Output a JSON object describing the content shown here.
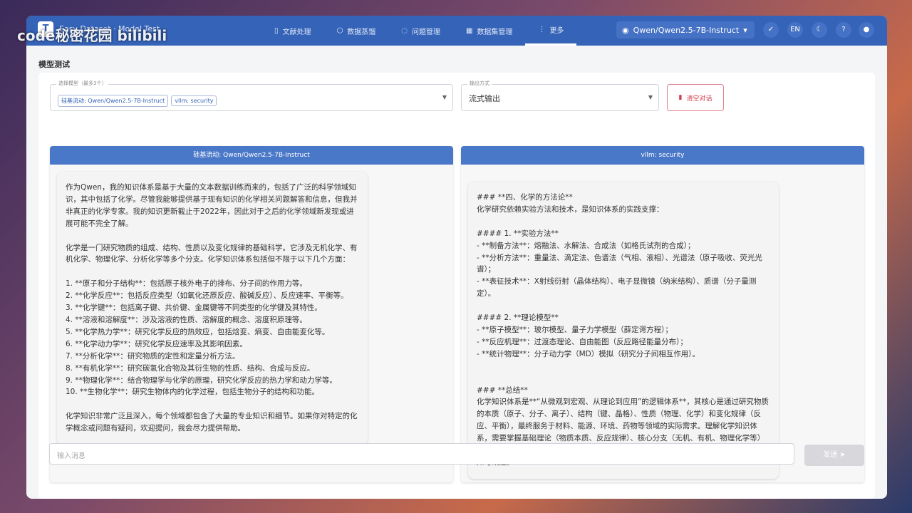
{
  "watermark": "code秘密花园 bilibili",
  "header": {
    "logo": "T",
    "project": "Easy Dataset · Model Test",
    "nav": [
      {
        "icon": "document-icon",
        "label": "文献处理"
      },
      {
        "icon": "cube-icon",
        "label": "数据蒸馏"
      },
      {
        "icon": "chat-icon",
        "label": "问题管理"
      },
      {
        "icon": "dataset-icon",
        "label": "数据集管理"
      },
      {
        "icon": "more-vert-icon",
        "label": "更多"
      }
    ],
    "model": "Qwen/Qwen2.5-7B-Instruct",
    "icons": [
      "check-icon",
      "EN",
      "moon-icon",
      "help-icon",
      "github-icon"
    ]
  },
  "page_title": "模型测试",
  "controls": {
    "model_label": "选择模型（最多3个）",
    "models": [
      "硅基流动: Qwen/Qwen2.5-7B-Instruct",
      "vllm: security"
    ],
    "output_label": "输出方式",
    "output_value": "流式输出",
    "clear_label": "清空对话"
  },
  "panes": [
    {
      "title": "硅基流动: Qwen/Qwen2.5-7B-Instruct",
      "text": "作为Qwen，我的知识体系是基于大量的文本数据训练而来的，包括了广泛的科学领域知识，其中包括了化学。尽管我能够提供基于现有知识的化学相关问题解答和信息，但我并非真正的化学专家。我的知识更新截止于2022年，因此对于之后的化学领域新发现或进展可能不完全了解。\n\n化学是一门研究物质的组成、结构、性质以及变化规律的基础科学。它涉及无机化学、有机化学、物理化学、分析化学等多个分支。化学知识体系包括但不限于以下几个方面：\n\n1. **原子和分子结构**：包括原子核外电子的排布、分子间的作用力等。\n2. **化学反应**：包括反应类型（如氧化还原反应、酸碱反应）、反应速率、平衡等。\n3. **化学键**：包括离子键、共价键、金属键等不同类型的化学键及其特性。\n4. **溶液和溶解度**：涉及溶液的性质、溶解度的概念、溶度积原理等。\n5. **化学热力学**：研究化学反应的热效应，包括焓变、熵变、自由能变化等。\n6. **化学动力学**：研究化学反应速率及其影响因素。\n7. **分析化学**：研究物质的定性和定量分析方法。\n8. **有机化学**：研究碳氢化合物及其衍生物的性质、结构、合成与反应。\n9. **物理化学**：结合物理学与化学的原理，研究化学反应的热力学和动力学等。\n10. **生物化学**：研究生物体内的化学过程，包括生物分子的结构和功能。\n\n化学知识非常广泛且深入，每个领域都包含了大量的专业知识和细节。如果你对特定的化学概念或问题有疑问，欢迎提问，我会尽力提供帮助。"
    },
    {
      "title": "vllm: security",
      "text": "### **四、化学的方法论**\n化学研究依赖实验方法和技术，是知识体系的实践支撑：\n\n#### 1. **实验方法**\n- **制备方法**：熔融法、水解法、合成法（如格氏试剂的合成）；\n- **分析方法**：重量法、滴定法、色谱法（气相、液相）、光谱法（原子吸收、荧光光谱）；\n- **表征技术**：X射线衍射（晶体结构）、电子显微镜（纳米结构）、质谱（分子量测定）。\n\n#### 2. **理论模型**\n- **原子模型**：玻尔模型、量子力学模型（薛定谔方程）；\n- **反应机理**：过渡态理论、自由能图（反应路径能量分布）；\n- **统计物理**：分子动力学（MD）模拟（研究分子间相互作用）。\n\n\n### **总结**\n化学知识体系是**“从微观到宏观、从理论到应用”的逻辑体系**，其核心是通过研究物质的本质（原子、分子、离子）、结构（键、晶格）、性质（物理、化学）和变化规律（反应、平衡），最终服务于材料、能源、环境、药物等领域的实际需求。理解化学知识体系，需要掌握基础理论（物质本质、反应规律）、核心分支（无机、有机、物理化学等）和应用领域（材料、能源、环境等），并结合实验方法和技术手段，实现对物质世界的认知与改造。"
    }
  ],
  "input": {
    "placeholder": "输入消息",
    "send": "发送"
  }
}
